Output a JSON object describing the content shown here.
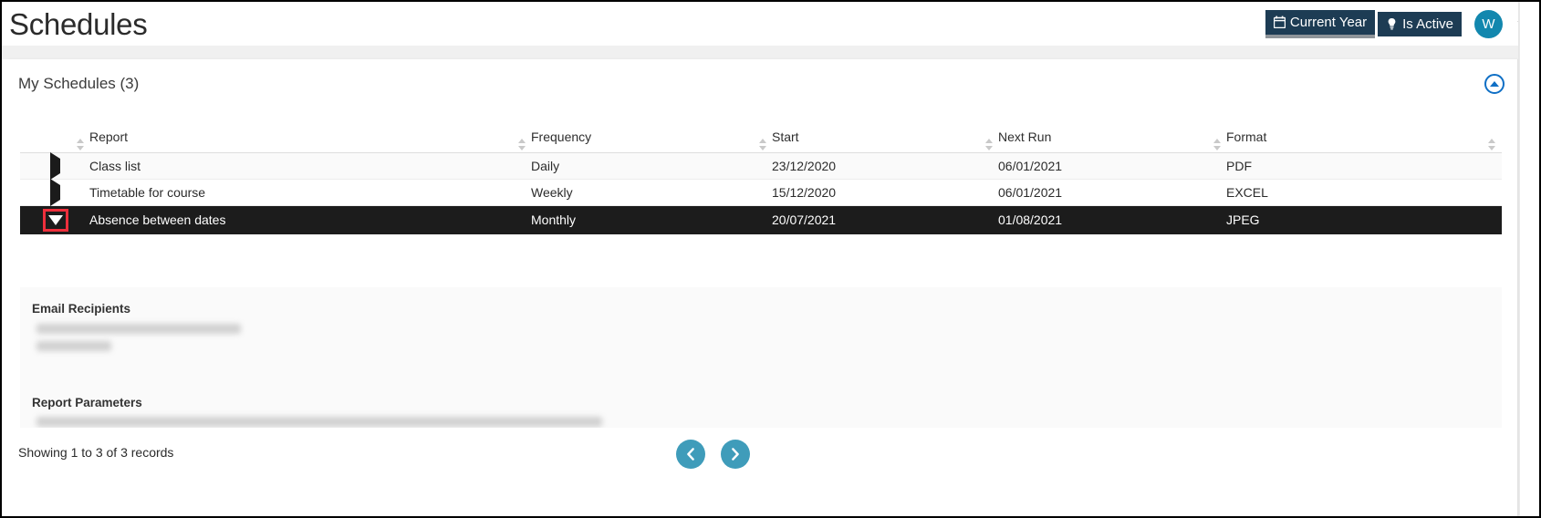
{
  "header": {
    "title": "Schedules",
    "badges": [
      {
        "label": "Current Year",
        "icon": "calendar-icon",
        "active": true
      },
      {
        "label": "Is Active",
        "icon": "lightbulb-icon",
        "active": false
      }
    ],
    "avatar_initial": "W",
    "dropdown_icon": "caret-down-icon",
    "badge_bg": "#1d3c54",
    "avatar_bg": "#1287ae"
  },
  "card": {
    "title": "My Schedules (3)",
    "collapse_icon": "chevron-up-circle-icon",
    "collapse_color": "#0f6fc5"
  },
  "table": {
    "columns": [
      {
        "key": "toggle",
        "label": "",
        "sortable": false
      },
      {
        "key": "report",
        "label": "Report",
        "sortable": true
      },
      {
        "key": "frequency",
        "label": "Frequency",
        "sortable": true
      },
      {
        "key": "start",
        "label": "Start",
        "sortable": true
      },
      {
        "key": "next_run",
        "label": "Next Run",
        "sortable": true
      },
      {
        "key": "format",
        "label": "Format",
        "sortable": true
      }
    ],
    "rows": [
      {
        "toggle": "expand-arrow-right",
        "report": "Class list",
        "frequency": "Daily",
        "start": "23/12/2020",
        "next_run": "06/01/2021",
        "format": "PDF",
        "selected": false
      },
      {
        "toggle": "expand-arrow-right",
        "report": "Timetable for course",
        "frequency": "Weekly",
        "start": "15/12/2020",
        "next_run": "06/01/2021",
        "format": "EXCEL",
        "selected": false
      },
      {
        "toggle": "collapse-arrow-down",
        "report": "Absence between dates",
        "frequency": "Monthly",
        "start": "20/07/2021",
        "next_run": "01/08/2021",
        "format": "JPEG",
        "selected": true
      }
    ]
  },
  "detail": {
    "email_recipients_label": "Email Recipients",
    "email_recipients_values": [
      "",
      ""
    ],
    "report_parameters_label": "Report Parameters",
    "report_parameters_value": ""
  },
  "footer": {
    "record_summary": "Showing 1 to 3 of 3 records",
    "prev_icon": "chevron-left-icon",
    "next_icon": "chevron-right-icon",
    "pager_color": "#3f9cba"
  },
  "annotation": {
    "highlight_color": "#ee2f3c",
    "highlight_target": "collapse-arrow-down"
  }
}
